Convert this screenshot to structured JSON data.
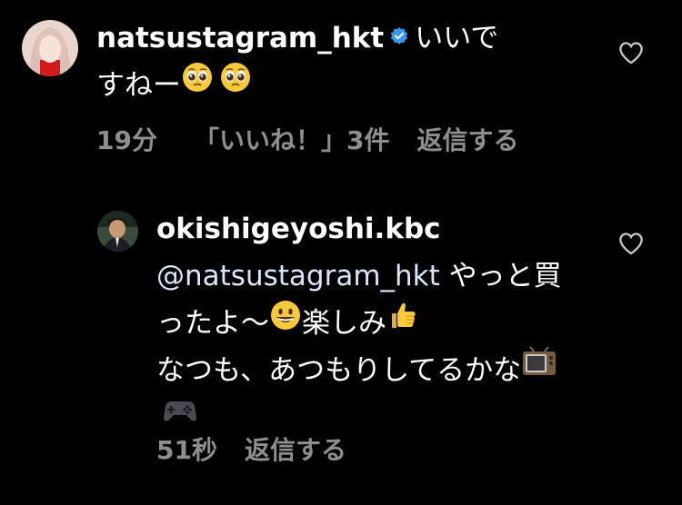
{
  "comments": [
    {
      "username": "natsustagram_hkt",
      "verified": true,
      "text_part1": "いいで",
      "text_part2": "すねー",
      "time": "19分",
      "likes": "「いいね！」3件",
      "reply": "返信する"
    },
    {
      "username": "okishigeyoshi.kbc",
      "verified": false,
      "mention": "@natsustagram_hkt",
      "text_part1": " やっと買ったよ〜",
      "text_part2": "楽しみ",
      "text_part3": "なつも、あつもりしてるかな",
      "time": "51秒",
      "reply": "返信する"
    }
  ],
  "icons": {
    "verified": "verified-badge-icon",
    "like": "heart-outline-icon",
    "emoji_pleading": "pleading-face-emoji",
    "emoji_smile": "grinning-face-emoji",
    "emoji_thumbs": "thumbs-up-emoji",
    "emoji_tv": "television-emoji",
    "emoji_game": "video-game-emoji"
  },
  "colors": {
    "background": "#000000",
    "text": "#ffffff",
    "meta": "#8e8e8e",
    "verified": "#3797f0",
    "mention": "#dbe7f8"
  }
}
